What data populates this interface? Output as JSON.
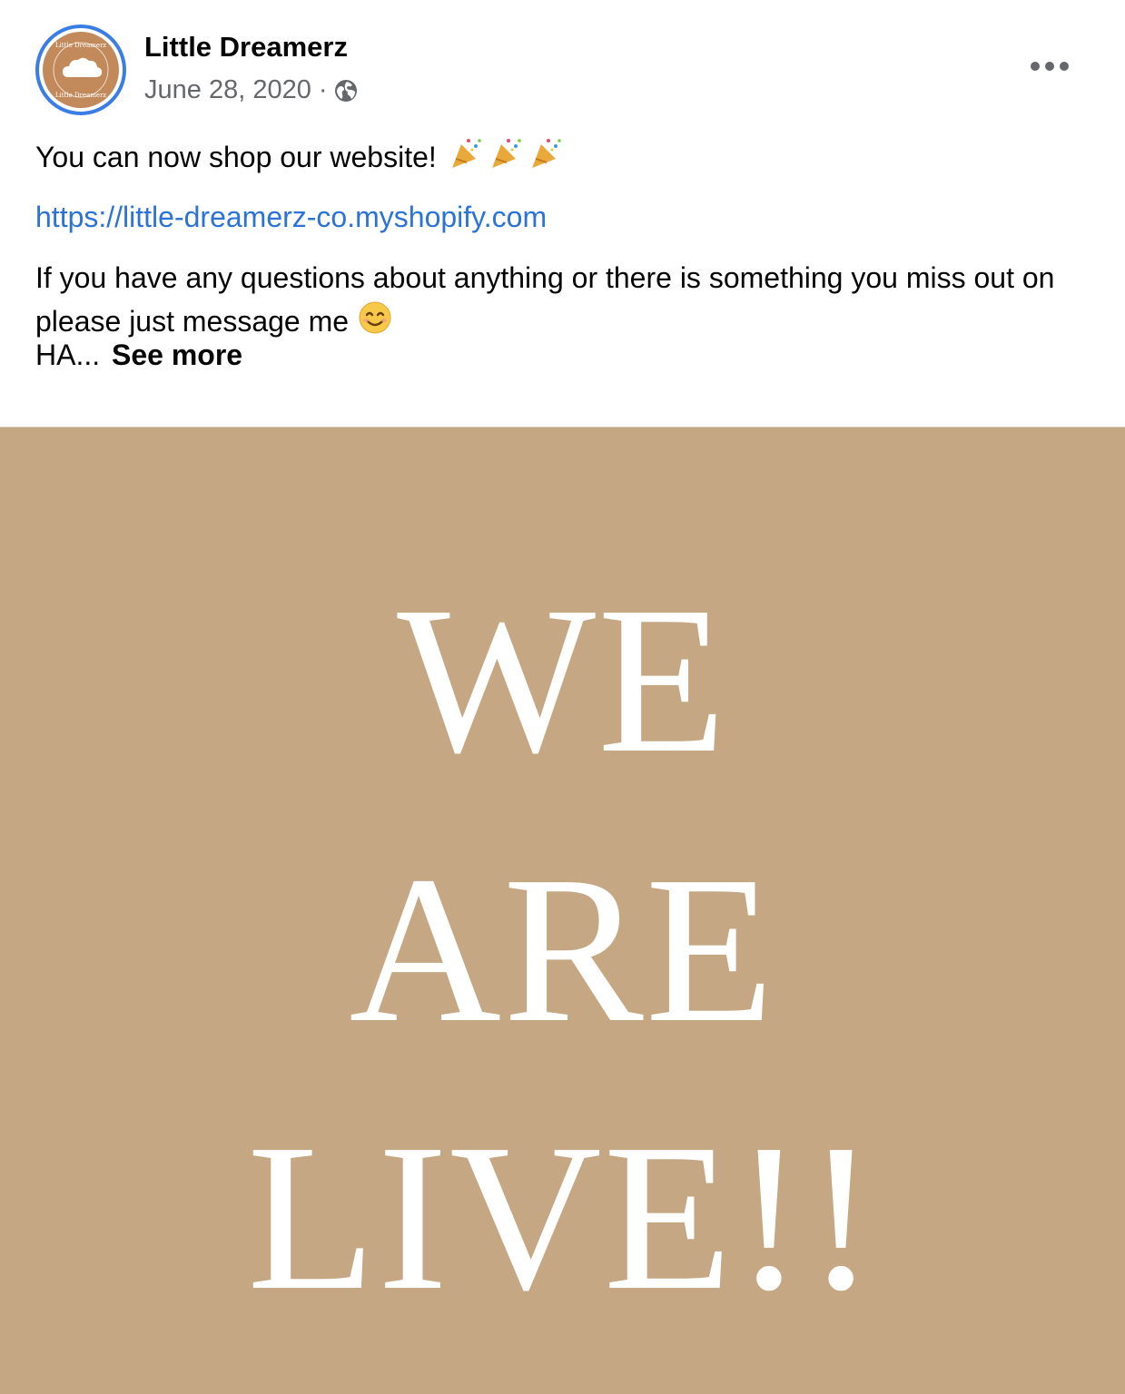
{
  "post": {
    "page_name": "Little Dreamerz",
    "date": "June 28, 2020",
    "separator": "·",
    "privacy_icon": "globe-icon",
    "more_icon": "ellipsis-icon",
    "avatar": {
      "logo_text": "Little Dreamerz",
      "icon": "cloud-icon",
      "ring_color": "#3a7de6",
      "fill_color": "#c2895a"
    },
    "text": {
      "line1": "You can now shop our website!",
      "line1_emoji": [
        "party-popper-emoji",
        "party-popper-emoji",
        "party-popper-emoji"
      ],
      "link": "https://little-dreamerz-co.myshopify.com",
      "paragraph": "If you have any questions about anything or there is something you miss out on please just message me",
      "paragraph_emoji": "smiling-face-emoji",
      "truncated": "HA...",
      "see_more": "See more"
    },
    "image": {
      "lines": [
        "WE",
        "ARE",
        "LIVE!!"
      ],
      "background_color": "#c5a883"
    }
  },
  "colors": {
    "link": "#2b73d9",
    "secondary_text": "#65676b",
    "primary_text": "#050505"
  }
}
